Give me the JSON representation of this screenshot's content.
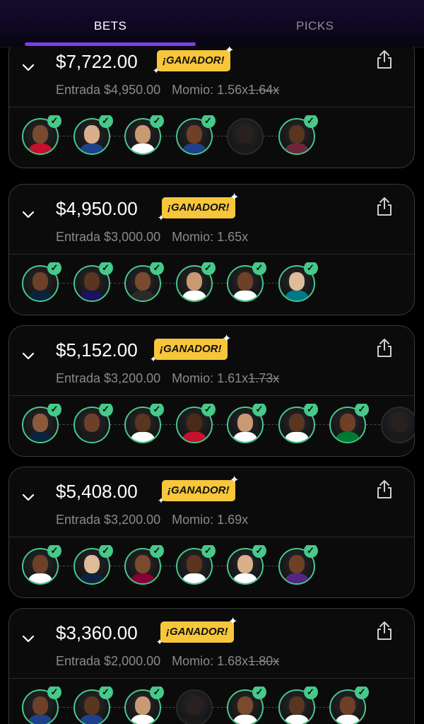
{
  "tabs": {
    "bets": "BETS",
    "picks": "PICKS"
  },
  "labels": {
    "entry_prefix": "Entrada",
    "odds_prefix": "Momio:",
    "winner_badge": "¡GANADOR!"
  },
  "colors": {
    "accent": "#7c3df0",
    "badge": "#f7c63a",
    "check": "#46c98a"
  },
  "bets": [
    {
      "payout": "$7,722.00",
      "entry": "$4,950.00",
      "odds": "1.56x",
      "old_odds": "1.64x",
      "picks": [
        {
          "status": "won",
          "skin": "#7a4a2e",
          "shirt": "#c8102e"
        },
        {
          "status": "won",
          "skin": "#d9b08c",
          "shirt": "#1d428a"
        },
        {
          "status": "won",
          "skin": "#c89a74",
          "shirt": "#ffffff"
        },
        {
          "status": "won",
          "skin": "#6e4028",
          "shirt": "#1d428a"
        },
        {
          "status": "pending",
          "skin": "#2a2020",
          "shirt": "#1a1a1a"
        },
        {
          "status": "won",
          "skin": "#5a3520",
          "shirt": "#6f263d"
        }
      ]
    },
    {
      "payout": "$4,950.00",
      "entry": "$3,000.00",
      "odds": "1.65x",
      "old_odds": "",
      "picks": [
        {
          "status": "won",
          "skin": "#6e4028",
          "shirt": "#0c2340"
        },
        {
          "status": "won",
          "skin": "#5a3520",
          "shirt": "#1d1160"
        },
        {
          "status": "won",
          "skin": "#7a4a2e",
          "shirt": "#2a2a2a"
        },
        {
          "status": "won",
          "skin": "#c89a74",
          "shirt": "#ffffff"
        },
        {
          "status": "won",
          "skin": "#6e4028",
          "shirt": "#ffffff"
        },
        {
          "status": "won",
          "skin": "#e0bb98",
          "shirt": "#00788c"
        }
      ]
    },
    {
      "payout": "$5,152.00",
      "entry": "$3,200.00",
      "odds": "1.61x",
      "old_odds": "1.73x",
      "picks": [
        {
          "status": "won",
          "skin": "#8a5a3b",
          "shirt": "#0c2340"
        },
        {
          "status": "won",
          "skin": "#6e4028",
          "shirt": "#1a1a1a"
        },
        {
          "status": "won",
          "skin": "#5a3520",
          "shirt": "#ffffff"
        },
        {
          "status": "won",
          "skin": "#4a2a18",
          "shirt": "#c8102e"
        },
        {
          "status": "won",
          "skin": "#c89a74",
          "shirt": "#ffffff"
        },
        {
          "status": "won",
          "skin": "#5a3520",
          "shirt": "#ffffff"
        },
        {
          "status": "won",
          "skin": "#6e4028",
          "shirt": "#007a33"
        },
        {
          "status": "pending",
          "skin": "#2a2020",
          "shirt": "#1a1a1a"
        }
      ]
    },
    {
      "payout": "$5,408.00",
      "entry": "$3,200.00",
      "odds": "1.69x",
      "old_odds": "",
      "picks": [
        {
          "status": "won",
          "skin": "#6e4028",
          "shirt": "#ffffff"
        },
        {
          "status": "won",
          "skin": "#e0bb98",
          "shirt": "#0e2240"
        },
        {
          "status": "won",
          "skin": "#7a4a2e",
          "shirt": "#860038"
        },
        {
          "status": "won",
          "skin": "#5a3520",
          "shirt": "#ffffff"
        },
        {
          "status": "won",
          "skin": "#d9b08c",
          "shirt": "#ffffff"
        },
        {
          "status": "won",
          "skin": "#6e4028",
          "shirt": "#552583"
        }
      ]
    },
    {
      "payout": "$3,360.00",
      "entry": "$2,000.00",
      "odds": "1.68x",
      "old_odds": "1.80x",
      "picks": [
        {
          "status": "won",
          "skin": "#6e4028",
          "shirt": "#1d428a"
        },
        {
          "status": "won",
          "skin": "#5a3520",
          "shirt": "#1d428a"
        },
        {
          "status": "won",
          "skin": "#c89a74",
          "shirt": "#ffffff"
        },
        {
          "status": "pending",
          "skin": "#2a2020",
          "shirt": "#1a1a1a"
        },
        {
          "status": "won",
          "skin": "#7a4a2e",
          "shirt": "#ffffff"
        },
        {
          "status": "won",
          "skin": "#5a3520",
          "shirt": "#ffffff"
        },
        {
          "status": "won",
          "skin": "#6e4028",
          "shirt": "#ffffff"
        }
      ]
    }
  ]
}
